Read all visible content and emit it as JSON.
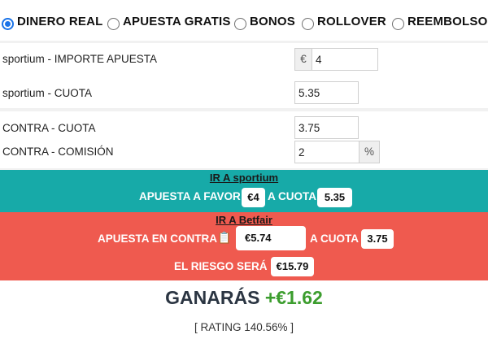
{
  "modes": {
    "options": [
      {
        "label": "DINERO REAL",
        "selected": true
      },
      {
        "label": "APUESTA GRATIS",
        "selected": false
      },
      {
        "label": "BONOS",
        "selected": false
      },
      {
        "label": "ROLLOVER",
        "selected": false
      },
      {
        "label": "REEMBOLSO",
        "selected": false
      }
    ]
  },
  "back": {
    "stake_label": "sportium - IMPORTE APUESTA",
    "currency_symbol": "€",
    "stake_value": "4",
    "odds_label": "sportium - CUOTA",
    "odds_value": "5.35"
  },
  "lay": {
    "odds_label": "CONTRA - CUOTA",
    "odds_value": "3.75",
    "commission_label": "CONTRA - COMISIÓN",
    "commission_value": "2",
    "commission_unit": "%"
  },
  "back_band": {
    "link_text": "IR A sportium",
    "bet_label": "APUESTA A FAVOR",
    "bet_value": "€4",
    "odds_label": "A CUOTA",
    "odds_value": "5.35",
    "color": "#17aaa8"
  },
  "lay_band": {
    "link_text": "IR A Betfair",
    "bet_label": "APUESTA EN CONTRA",
    "copy_icon": "clipboard-icon",
    "bet_value": "€5.74",
    "odds_label": "A CUOTA",
    "odds_value": "3.75",
    "risk_label": "EL RIESGO SERÁ",
    "risk_value": "€15.79",
    "color": "#ef5a4f"
  },
  "result": {
    "label": "GANARÁS",
    "amount": "+€1.62",
    "rating_text": "[ RATING 140.56% ]"
  }
}
